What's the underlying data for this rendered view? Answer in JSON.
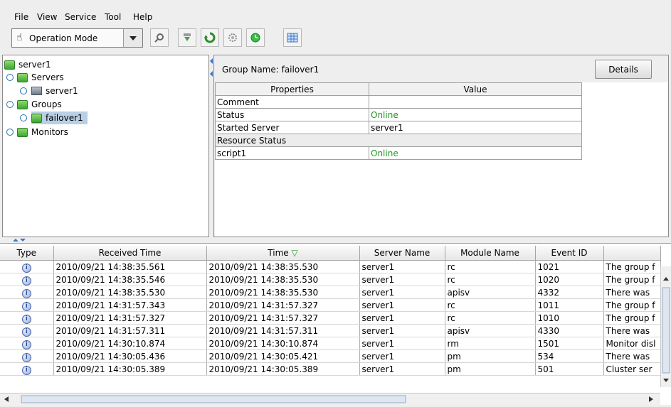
{
  "menu": {
    "items": [
      "File",
      "View",
      "Service",
      "Tool",
      "Help"
    ]
  },
  "toolbar": {
    "mode_value": "Operation Mode",
    "buttons": [
      "search-icon",
      "import-icon",
      "refresh-icon",
      "gear-icon",
      "clock-icon",
      "grid-icon"
    ]
  },
  "tree": {
    "root": "server1",
    "servers": "Servers",
    "server_child": "server1",
    "groups": "Groups",
    "group_child": "failover1",
    "monitors": "Monitors"
  },
  "detail": {
    "group_name": "Group Name: failover1",
    "details_label": "Details",
    "columns": [
      "Properties",
      "Value"
    ],
    "rows": [
      [
        "Comment",
        ""
      ],
      [
        "Status",
        "Online"
      ],
      [
        "Started Server",
        "server1"
      ]
    ],
    "section": "Resource Status",
    "resource_rows": [
      [
        "script1",
        "Online"
      ]
    ]
  },
  "log": {
    "columns": [
      "Type",
      "Received Time",
      "Time",
      "Server Name",
      "Module Name",
      "Event ID",
      ""
    ],
    "rows": [
      [
        "",
        "2010/09/21 14:38:35.561",
        "2010/09/21 14:38:35.530",
        "server1",
        "rc",
        "1021",
        "The group f"
      ],
      [
        "",
        "2010/09/21 14:38:35.546",
        "2010/09/21 14:38:35.530",
        "server1",
        "rc",
        "1020",
        "The group f"
      ],
      [
        "",
        "2010/09/21 14:38:35.530",
        "2010/09/21 14:38:35.530",
        "server1",
        "apisv",
        "4332",
        "There was"
      ],
      [
        "",
        "2010/09/21 14:31:57.343",
        "2010/09/21 14:31:57.327",
        "server1",
        "rc",
        "1011",
        "The group f"
      ],
      [
        "",
        "2010/09/21 14:31:57.327",
        "2010/09/21 14:31:57.327",
        "server1",
        "rc",
        "1010",
        "The group f"
      ],
      [
        "",
        "2010/09/21 14:31:57.311",
        "2010/09/21 14:31:57.311",
        "server1",
        "apisv",
        "4330",
        "There was"
      ],
      [
        "",
        "2010/09/21 14:30:10.874",
        "2010/09/21 14:30:10.874",
        "server1",
        "rm",
        "1501",
        "Monitor disl"
      ],
      [
        "",
        "2010/09/21 14:30:05.436",
        "2010/09/21 14:30:05.421",
        "server1",
        "pm",
        "534",
        "There was"
      ],
      [
        "",
        "2010/09/21 14:30:05.389",
        "2010/09/21 14:30:05.389",
        "server1",
        "pm",
        "501",
        "Cluster ser"
      ]
    ]
  },
  "colors": {
    "online": "#1c9a1c",
    "selection": "#b8cfe5"
  }
}
